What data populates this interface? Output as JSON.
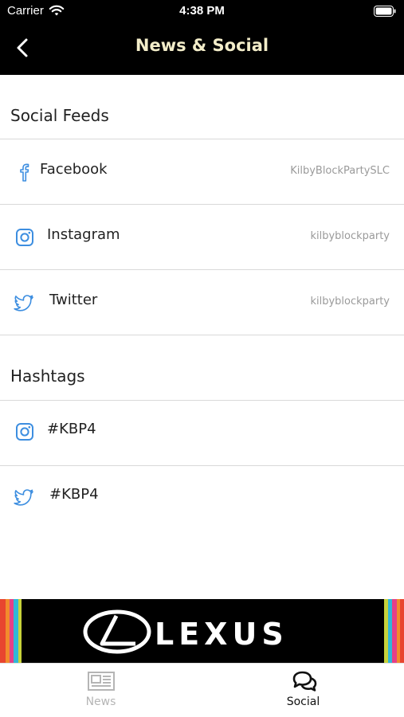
{
  "status_bar": {
    "carrier": "Carrier",
    "time": "4:38 PM"
  },
  "nav": {
    "title": "News & Social",
    "back_icon": "chevron-left-icon"
  },
  "social_feeds": {
    "header": "Social Feeds",
    "items": [
      {
        "label": "Facebook",
        "handle": "KilbyBlockPartySLC",
        "icon": "facebook-icon"
      },
      {
        "label": "Instagram",
        "handle": "kilbyblockparty",
        "icon": "instagram-icon"
      },
      {
        "label": "Twitter",
        "handle": "kilbyblockparty",
        "icon": "twitter-icon"
      }
    ]
  },
  "hashtags": {
    "header": "Hashtags",
    "items": [
      {
        "label": "#KBP4",
        "icon": "instagram-icon"
      },
      {
        "label": "#KBP4",
        "icon": "twitter-icon"
      }
    ]
  },
  "ad": {
    "brand": "LEXUS"
  },
  "tabs": [
    {
      "label": "News",
      "icon": "newspaper-icon",
      "active": false
    },
    {
      "label": "Social",
      "icon": "chat-bubbles-icon",
      "active": true
    }
  ],
  "colors": {
    "icon_blue": "#3d8ee0",
    "title_cream": "#f3edc9",
    "inactive_tab": "#b5b5b5",
    "active_tab": "#111111"
  }
}
